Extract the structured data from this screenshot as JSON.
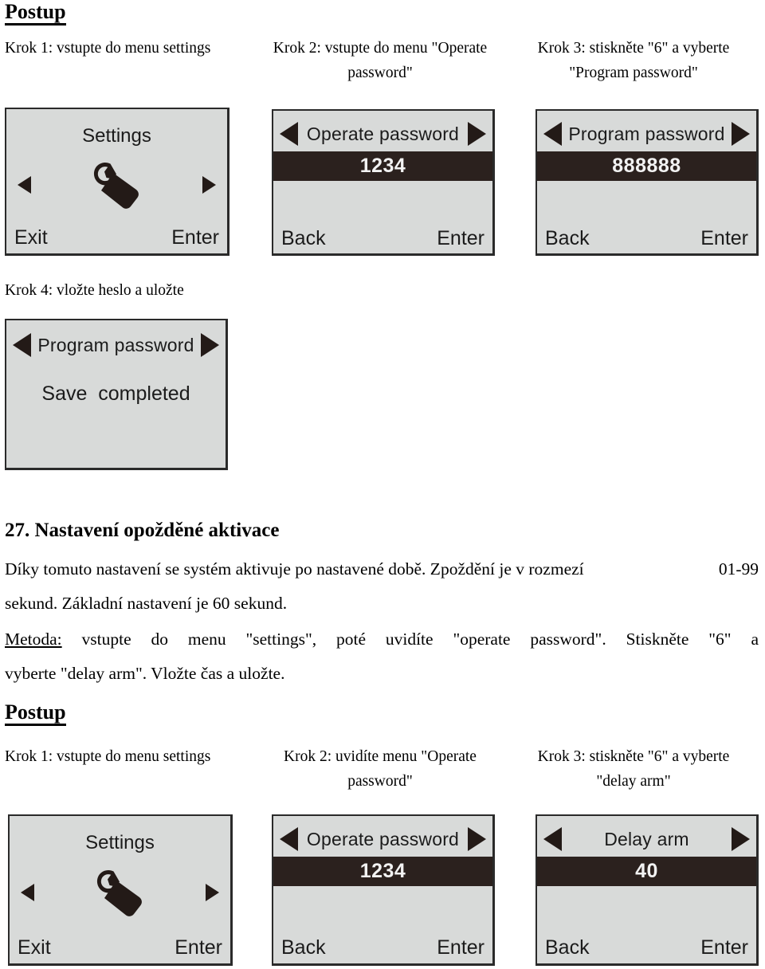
{
  "document": {
    "headings": {
      "postup_top": "Postup",
      "postup_bottom": "Postup",
      "section_27": "27. Nastavení opožděné aktivace"
    },
    "paragraph_27": {
      "line1_left": "Díky tomuto nastavení se systém aktivuje po nastavené době. Zpoždění je v rozmezí",
      "line1_right": "01-99",
      "line2": "sekund. Základní nastavení je 60 sekund."
    },
    "metoda": {
      "label": "Metoda:",
      "line1_parts": [
        "vstupte",
        "do",
        "menu",
        "\"settings\",",
        "poté",
        "uvidíte",
        "\"operate",
        "password\".",
        "Stiskněte",
        "\"6\"",
        "a"
      ],
      "line2": "vyberte \"delay arm\". Vložte čas a uložte."
    }
  },
  "procedure_one": {
    "steps": [
      {
        "caption_line1": "Krok 1: vstupte do menu settings",
        "caption_line2": ""
      },
      {
        "caption_line1": "Krok 2: vstupte do menu \"Operate",
        "caption_line2": "password\""
      },
      {
        "caption_line1": "Krok 3: stiskněte \"6\" a vyberte",
        "caption_line2": "\"Program password\""
      }
    ],
    "step4_caption": "Krok 4: vložte heslo a uložte",
    "screens": {
      "settings": {
        "title": "Settings",
        "icon": "wrench-icon",
        "left_button": "Exit",
        "right_button": "Enter"
      },
      "operate_password": {
        "title": "Operate password",
        "value": "1234",
        "left_button": "Back",
        "right_button": "Enter"
      },
      "program_password": {
        "title": "Program password",
        "value": "888888",
        "left_button": "Back",
        "right_button": "Enter"
      },
      "save_completed": {
        "title": "Program password",
        "message": "Save  completed"
      }
    }
  },
  "procedure_two": {
    "steps": [
      {
        "caption_line1": "Krok 1: vstupte do menu settings",
        "caption_line2": ""
      },
      {
        "caption_line1": "Krok 2: uvidíte menu \"Operate",
        "caption_line2": "password\""
      },
      {
        "caption_line1": "Krok 3: stiskněte \"6\" a vyberte",
        "caption_line2": "\"delay arm\""
      }
    ],
    "screens": {
      "settings": {
        "title": "Settings",
        "icon": "wrench-icon",
        "left_button": "Exit",
        "right_button": "Enter"
      },
      "operate_password": {
        "title": "Operate password",
        "value": "1234",
        "left_button": "Back",
        "right_button": "Enter"
      },
      "delay_arm": {
        "title": "Delay  arm",
        "value": "40",
        "left_button": "Back",
        "right_button": "Enter"
      }
    }
  },
  "colors": {
    "lcd_background": "#d8dad9",
    "lcd_border": "#2a2a2a",
    "lcd_highlight": "#2b211e",
    "lcd_highlight_text": "#f2f2f2",
    "text": "#000000"
  }
}
